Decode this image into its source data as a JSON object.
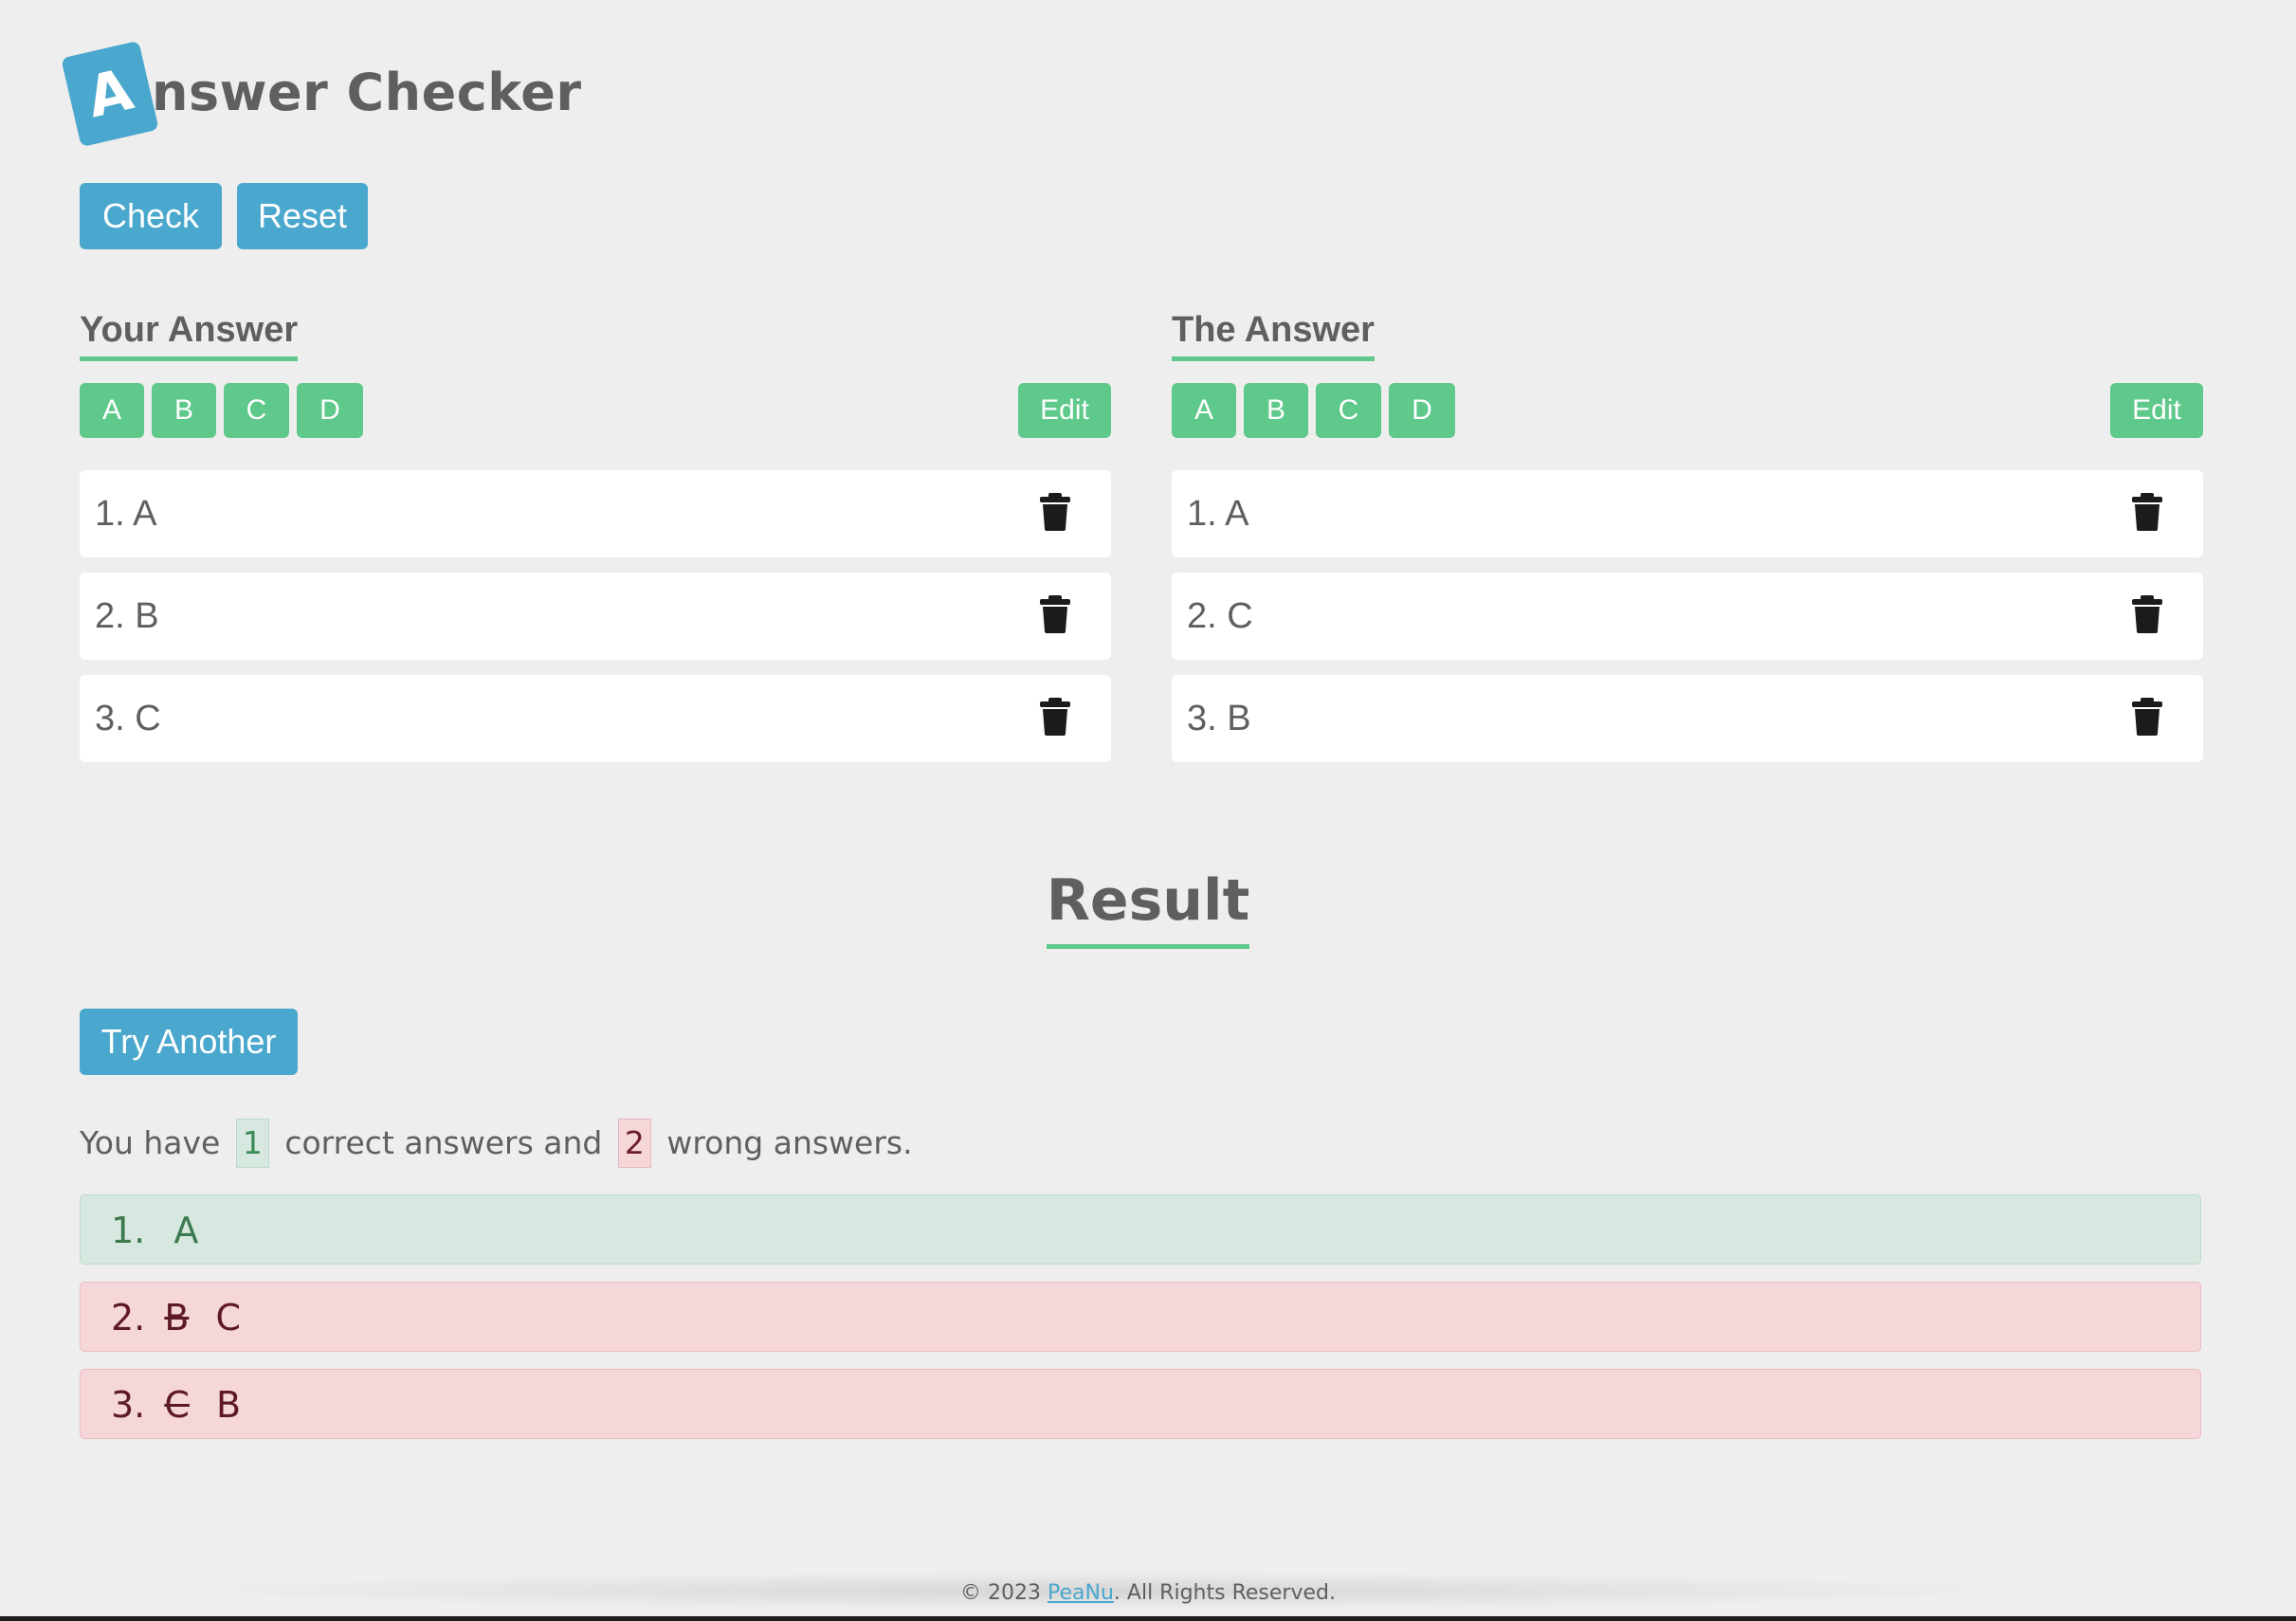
{
  "header": {
    "logo_letter": "A",
    "logo_rest": "nswer Checker"
  },
  "toolbar": {
    "check_label": "Check",
    "reset_label": "Reset"
  },
  "your_answer": {
    "title": "Your Answer",
    "choices": [
      "A",
      "B",
      "C",
      "D"
    ],
    "edit_label": "Edit",
    "items": [
      "1. A",
      "2. B",
      "3. C"
    ]
  },
  "the_answer": {
    "title": "The Answer",
    "choices": [
      "A",
      "B",
      "C",
      "D"
    ],
    "edit_label": "Edit",
    "items": [
      "1. A",
      "2. C",
      "3. B"
    ]
  },
  "result": {
    "title": "Result",
    "try_another_label": "Try Another",
    "summary_prefix": "You have",
    "correct_count": "1",
    "summary_middle": "correct answers and",
    "wrong_count": "2",
    "summary_suffix": "wrong answers.",
    "rows": [
      {
        "num": "1.",
        "given": "",
        "correct": "A",
        "status": "correct"
      },
      {
        "num": "2.",
        "given": "B",
        "correct": "C",
        "status": "wrong"
      },
      {
        "num": "3.",
        "given": "C",
        "correct": "B",
        "status": "wrong"
      }
    ]
  },
  "footer": {
    "prefix": "© 2023",
    "link_text": "PeaNu",
    "suffix": ". All Rights Reserved."
  },
  "colors": {
    "background": "#eeeeee",
    "primary_blue": "#4aa7cd",
    "accent_green": "#5ec98b",
    "correct_bg": "#d6e8df",
    "wrong_bg": "#f5d6d9",
    "text": "#5f5f5f"
  },
  "icons": {
    "delete": "trash-icon"
  }
}
